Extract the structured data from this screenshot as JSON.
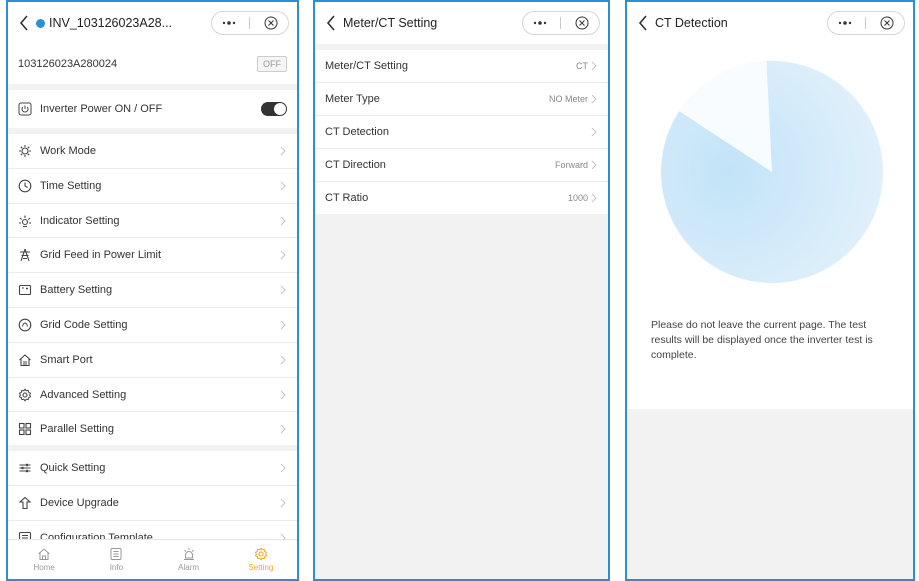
{
  "screen1": {
    "title": "INV_103126023A28...",
    "serial": "103126023A280024",
    "serial_badge": "OFF",
    "power_label": "Inverter Power ON / OFF",
    "items": [
      {
        "label": "Work Mode",
        "icon": "work-mode-icon"
      },
      {
        "label": "Time Setting",
        "icon": "clock-icon"
      },
      {
        "label": "Indicator Setting",
        "icon": "indicator-icon"
      },
      {
        "label": "Grid Feed in Power Limit",
        "icon": "tower-icon"
      },
      {
        "label": "Battery Setting",
        "icon": "battery-icon"
      },
      {
        "label": "Grid Code Setting",
        "icon": "grid-code-icon"
      },
      {
        "label": "Smart Port",
        "icon": "smart-port-icon"
      },
      {
        "label": "Advanced Setting",
        "icon": "gear-icon"
      },
      {
        "label": "Parallel Setting",
        "icon": "parallel-icon"
      },
      {
        "label": "Quick Setting",
        "icon": "sliders-icon"
      },
      {
        "label": "Device Upgrade",
        "icon": "upgrade-icon"
      },
      {
        "label": "Configuration Template",
        "icon": "template-icon"
      }
    ],
    "tabs": [
      {
        "label": "Home",
        "active": false
      },
      {
        "label": "Info",
        "active": false
      },
      {
        "label": "Alarm",
        "active": false
      },
      {
        "label": "Setting",
        "active": true
      }
    ]
  },
  "screen2": {
    "title": "Meter/CT Setting",
    "rows": [
      {
        "label": "Meter/CT Setting",
        "value": "CT"
      },
      {
        "label": "Meter Type",
        "value": "NO Meter"
      },
      {
        "label": "CT Detection",
        "value": ""
      },
      {
        "label": "CT Direction",
        "value": "Forward"
      },
      {
        "label": "CT Ratio",
        "value": "1000"
      }
    ]
  },
  "screen3": {
    "title": "CT Detection",
    "message": "Please do not leave the current page. The test results will be displayed once the inverter test is complete.",
    "progress": 0.91
  },
  "colors": {
    "frame": "#2b8fd6",
    "active_tab": "#f5a623",
    "pie_light": "#d7ecfa",
    "pie_dark": "#b4dcf5"
  }
}
